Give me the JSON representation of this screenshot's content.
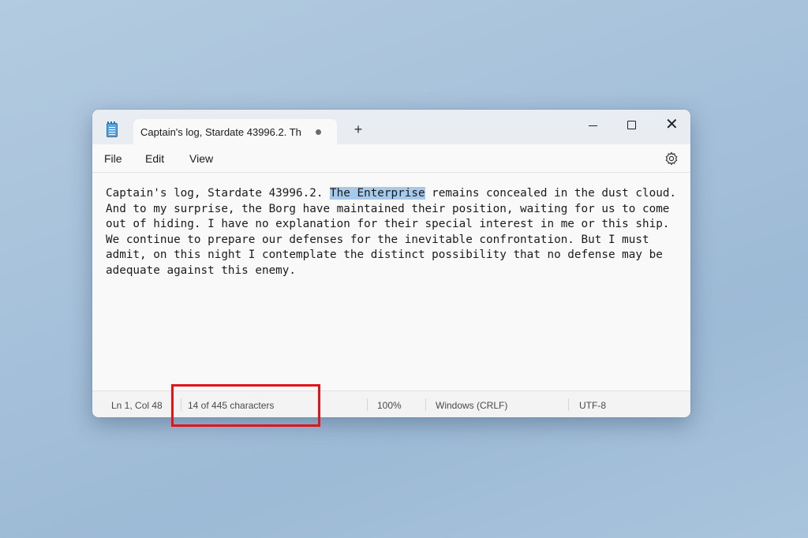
{
  "window": {
    "tab_title": "Captain's log, Stardate 43996.2. Th",
    "new_tab_symbol": "+",
    "close_symbol": "✕"
  },
  "menu": {
    "file": "File",
    "edit": "Edit",
    "view": "View"
  },
  "editor": {
    "line1_before": "Captain's log, Stardate 43996.2. ",
    "line1_selected": "The Enterprise",
    "line1_after": " remains concealed in the dust cloud.",
    "line2": "And to my surprise, the Borg have maintained their position, waiting for us to come",
    "line3": "out of hiding. I have no explanation for their special interest in me or this ship.",
    "line4": "We continue to prepare our defenses for the inevitable confrontation. But I must",
    "line5": "admit, on this night I contemplate the distinct possibility that no defense may be",
    "line6": "adequate against this enemy."
  },
  "status": {
    "position": "Ln 1, Col 48",
    "characters": "14 of 445 characters",
    "zoom": "100%",
    "line_ending": "Windows (CRLF)",
    "encoding": "UTF-8"
  },
  "icons": {
    "app": "notepad-icon",
    "settings": "gear-icon",
    "minimize": "minimize-icon",
    "maximize": "maximize-icon",
    "close": "close-icon",
    "unsaved": "unsaved-dot-icon"
  },
  "colors": {
    "selection": "#a7c9ea",
    "highlight_box": "#e0141b"
  }
}
